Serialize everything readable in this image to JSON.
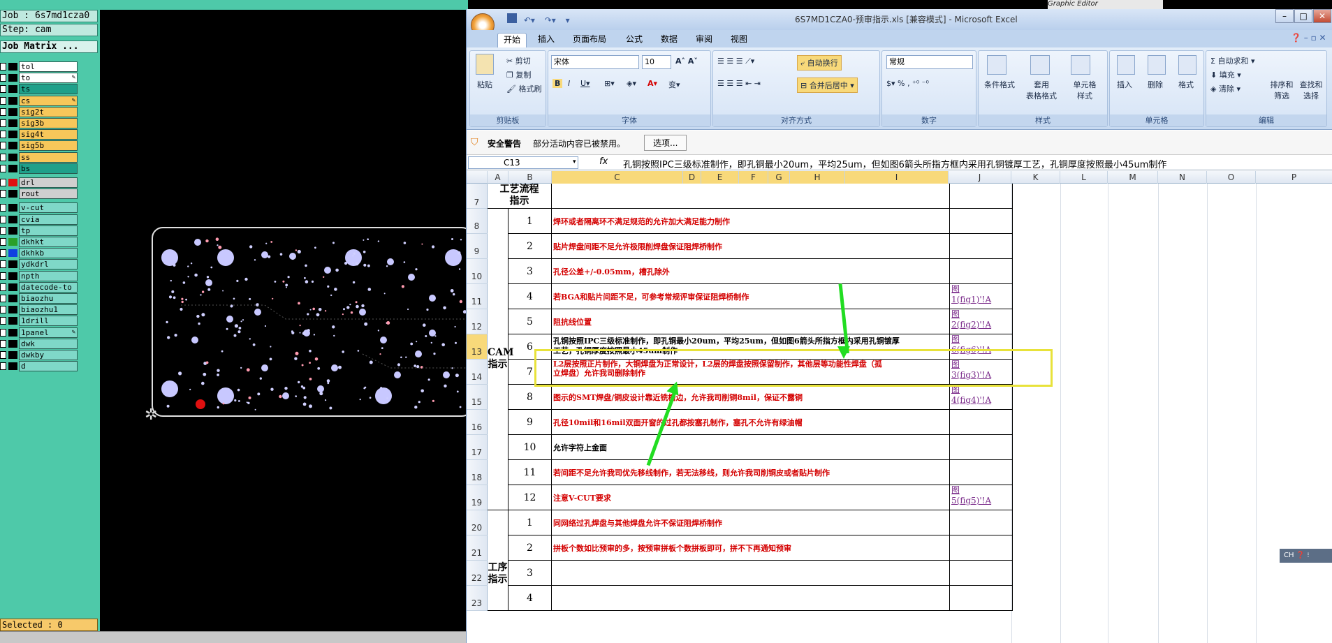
{
  "cam": {
    "job": "Job : 6s7md1cza0",
    "step": "Step: cam",
    "matrix_button": "Job Matrix ...",
    "selected": "Selected : 0",
    "editor_title": "Graphic Editor",
    "layers": [
      {
        "name": "tol",
        "color": "#ffffff",
        "swatch": "#000000"
      },
      {
        "name": "to",
        "color": "#ffffff",
        "swatch": "#000000",
        "mark": "✎"
      },
      {
        "name": "ts",
        "color": "#1fa08a",
        "swatch": "#000000"
      },
      {
        "name": "cs",
        "color": "#f7c75a",
        "swatch": "#000000",
        "mark": "✎"
      },
      {
        "name": "sig2t",
        "color": "#f7c75a",
        "swatch": "#000000"
      },
      {
        "name": "sig3b",
        "color": "#f7c75a",
        "swatch": "#000000"
      },
      {
        "name": "sig4t",
        "color": "#f7c75a",
        "swatch": "#000000"
      },
      {
        "name": "sig5b",
        "color": "#f7c75a",
        "swatch": "#000000"
      },
      {
        "name": "ss",
        "color": "#f7c75a",
        "swatch": "#000000"
      },
      {
        "name": "bs",
        "color": "#1fa08a",
        "swatch": "#000000"
      },
      {
        "name": "drl",
        "color": "#cfcfcf",
        "swatch": "#e01010"
      },
      {
        "name": "rout",
        "color": "#cfcfcf",
        "swatch": "#000000"
      },
      {
        "name": "v-cut",
        "color": "#7fd8c8",
        "swatch": "#000000"
      },
      {
        "name": "cvia",
        "color": "#7fd8c8",
        "swatch": "#000000"
      },
      {
        "name": "tp",
        "color": "#7fd8c8",
        "swatch": "#000000"
      },
      {
        "name": "dkhkt",
        "color": "#7fd8c8",
        "swatch": "#2aa02a"
      },
      {
        "name": "dkhkb",
        "color": "#7fd8c8",
        "swatch": "#1040e0"
      },
      {
        "name": "ydkdrl",
        "color": "#7fd8c8",
        "swatch": "#000000"
      },
      {
        "name": "npth",
        "color": "#7fd8c8",
        "swatch": "#000000"
      },
      {
        "name": "datecode-to",
        "color": "#7fd8c8",
        "swatch": "#000000"
      },
      {
        "name": "biaozhu",
        "color": "#7fd8c8",
        "swatch": "#000000"
      },
      {
        "name": "biaozhu1",
        "color": "#7fd8c8",
        "swatch": "#000000"
      },
      {
        "name": "1drill",
        "color": "#7fd8c8",
        "swatch": "#000000"
      },
      {
        "name": "1panel",
        "color": "#7fd8c8",
        "swatch": "#000000",
        "mark": "✎"
      },
      {
        "name": "dwk",
        "color": "#7fd8c8",
        "swatch": "#000000"
      },
      {
        "name": "dwkby",
        "color": "#7fd8c8",
        "swatch": "#000000"
      },
      {
        "name": "d",
        "color": "#7fd8c8",
        "swatch": "#000000"
      }
    ]
  },
  "excel": {
    "title": "6S7MD1CZA0-预审指示.xls [兼容模式] - Microsoft Excel",
    "tabs": [
      "开始",
      "插入",
      "页面布局",
      "公式",
      "数据",
      "审阅",
      "视图"
    ],
    "ribbon": {
      "clipboard": {
        "title": "剪贴板",
        "paste": "粘贴",
        "cut": "剪切",
        "copy": "复制",
        "format_painter": "格式刷"
      },
      "font": {
        "title": "字体",
        "name": "宋体",
        "size": "10"
      },
      "alignment": {
        "title": "对齐方式",
        "wrap": "自动换行",
        "merge": "合并后居中"
      },
      "number": {
        "title": "数字",
        "format": "常规"
      },
      "styles": {
        "title": "样式",
        "conditional": "条件格式",
        "table": "套用\n表格格式",
        "cell": "单元格\n样式"
      },
      "cells": {
        "title": "单元格",
        "insert": "插入",
        "delete": "删除",
        "format": "格式"
      },
      "editing": {
        "title": "编辑",
        "autosum": "自动求和",
        "fill": "填充",
        "clear": "清除",
        "sort": "排序和\n筛选",
        "find": "查找和\n选择"
      }
    },
    "security": {
      "label": "安全警告",
      "message": "部分活动内容已被禁用。",
      "button": "选项..."
    },
    "name_box": "C13",
    "formula": "孔铜按照IPC三级标准制作，即孔铜最小20um，平均25um，但如图6箭头所指方框内采用孔铜镀厚工艺，孔铜厚度按照最小45um制作",
    "columns": [
      "A",
      "B",
      "C",
      "D",
      "E",
      "F",
      "G",
      "H",
      "I",
      "J",
      "K",
      "L",
      "M",
      "N",
      "O",
      "P"
    ],
    "header_row": {
      "label": "工艺流程\n指示"
    },
    "cam_label": "CAM\n指示",
    "process_label": "工序\n指示",
    "rows": [
      {
        "row": "8",
        "num": "1",
        "text": "焊环或者隔离环不满足规范的允许加大满足能力制作",
        "link": ""
      },
      {
        "row": "9",
        "num": "2",
        "text": "贴片焊盘间距不足允许极限削焊盘保证阻焊桥制作",
        "link": ""
      },
      {
        "row": "10",
        "num": "3",
        "text": "孔径公差+/-0.05mm，槽孔除外",
        "link": ""
      },
      {
        "row": "11",
        "num": "4",
        "text": "若BGA和贴片间距不足，可参考常规评审保证阻焊桥制作",
        "link": "图\n1(fig1)'!A"
      },
      {
        "row": "12",
        "num": "5",
        "text": "阻抗线位置",
        "link": "图\n2(fig2)'!A"
      },
      {
        "row": "13",
        "num": "6",
        "text": "孔铜按照IPC三级标准制作，即孔铜最小20um，平均25um，但如图6箭头所指方框内采用孔铜镀厚\n工艺，孔铜厚度按照最小45um制作",
        "link": "图\n6(fig6)'!A"
      },
      {
        "row": "14",
        "num": "7",
        "text": "L2层按照正片制作，大铜焊盘为正常设计，L2层的焊盘按照保留制作，其他层等功能性焊盘（孤\n立焊盘）允许我司删除制作",
        "link": "图\n3(fig3)'!A"
      },
      {
        "row": "15",
        "num": "8",
        "text": "图示的SMT焊盘/铜皮设计靠近铣槽边，允许我司削铜8mil，保证不露铜",
        "link": "图\n4(fig4)'!A"
      },
      {
        "row": "16",
        "num": "9",
        "text": "孔径10mil和16mil双面开窗的过孔都按塞孔制作，塞孔不允许有绿油帽",
        "link": ""
      },
      {
        "row": "17",
        "num": "10",
        "text": "允许字符上金面",
        "link": ""
      },
      {
        "row": "18",
        "num": "11",
        "text": "若间距不足允许我司优先移线制作，若无法移线，则允许我司削铜皮或者贴片制作",
        "link": ""
      },
      {
        "row": "19",
        "num": "12",
        "text": "注意V-CUT要求",
        "link": "图\n5(fig5)'!A"
      },
      {
        "row": "20",
        "num": "1",
        "text": "同网络过孔焊盘与其他焊盘允许不保证阻焊桥制作",
        "link": ""
      },
      {
        "row": "21",
        "num": "2",
        "text": "拼板个数如比预审的多，按预审拼板个数拼板即可，拼不下再通知预审",
        "link": ""
      },
      {
        "row": "22",
        "num": "3",
        "text": "",
        "link": ""
      },
      {
        "row": "23",
        "num": "4",
        "text": "",
        "link": ""
      }
    ]
  },
  "ime": "CH"
}
